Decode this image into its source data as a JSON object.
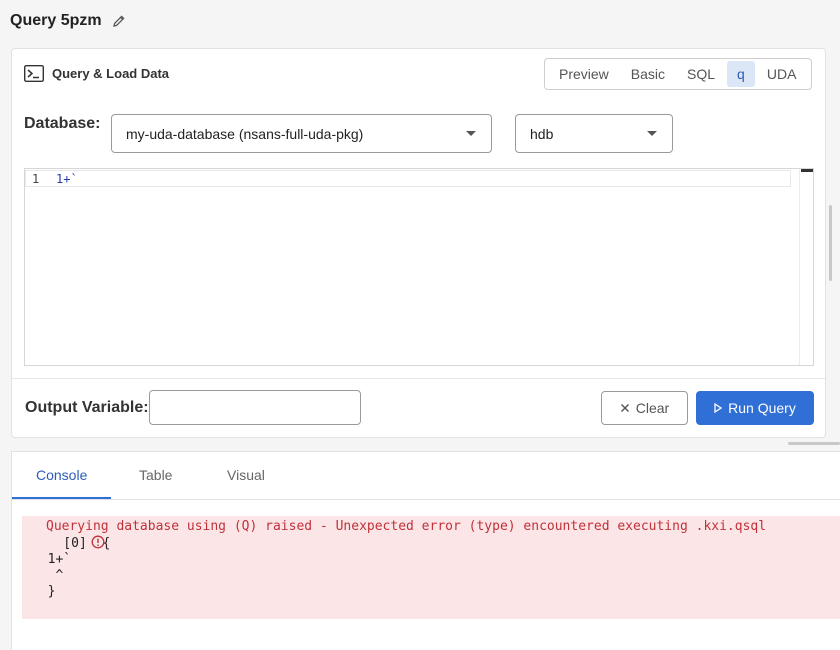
{
  "header": {
    "title": "Query 5pzm"
  },
  "panel": {
    "heading": "Query & Load Data",
    "mode_tabs": [
      {
        "label": "Preview",
        "active": false
      },
      {
        "label": "Basic",
        "active": false
      },
      {
        "label": "SQL",
        "active": false
      },
      {
        "label": "q",
        "active": true
      },
      {
        "label": "UDA",
        "active": false
      }
    ],
    "database_label": "Database:",
    "database_value": "my-uda-database (nsans-full-uda-pkg)",
    "tier_value": "hdb",
    "editor": {
      "line_number": "1",
      "code": "1+`"
    },
    "output_label": "Output Variable:",
    "output_value": "",
    "clear_label": "Clear",
    "run_label": "Run Query"
  },
  "output": {
    "tabs": [
      {
        "label": "Console",
        "active": true
      },
      {
        "label": "Table",
        "active": false
      },
      {
        "label": "Visual",
        "active": false
      }
    ],
    "error_lines": [
      "Querying database using (Q) raised - Unexpected error (type) encountered executing .kxi.qsql",
      "    [0]  {",
      "  1+`",
      "   ^",
      "  }"
    ]
  },
  "colors": {
    "accent": "#2f6fd6",
    "error_bg": "#fbe5e7",
    "error_text": "#c0323a"
  }
}
